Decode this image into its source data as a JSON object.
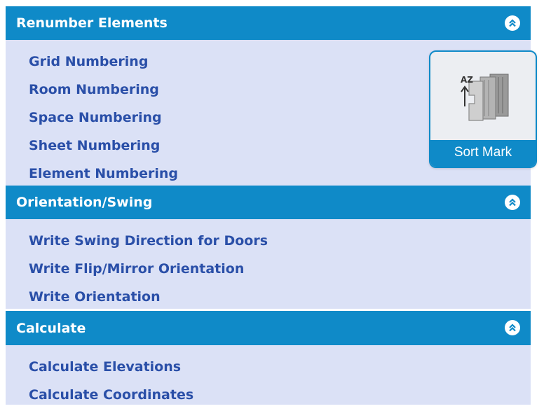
{
  "colors": {
    "header_bg": "#0f8ac8",
    "panel_bg": "#dbe1f6",
    "link_text": "#2a4fa8",
    "header_text": "#ffffff"
  },
  "sections": [
    {
      "title": "Renumber Elements",
      "collapse_icon": "double-chevron-up-icon",
      "items": [
        {
          "label": "Grid Numbering"
        },
        {
          "label": "Room Numbering"
        },
        {
          "label": "Space Numbering"
        },
        {
          "label": "Sheet Numbering"
        },
        {
          "label": "Element Numbering"
        }
      ]
    },
    {
      "title": "Orientation/Swing",
      "collapse_icon": "double-chevron-up-icon",
      "items": [
        {
          "label": "Write Swing Direction for Doors"
        },
        {
          "label": "Write Flip/Mirror Orientation"
        },
        {
          "label": "Write Orientation"
        }
      ]
    },
    {
      "title": "Calculate",
      "collapse_icon": "double-chevron-up-icon",
      "items": [
        {
          "label": "Calculate Elevations"
        },
        {
          "label": "Calculate Coordinates"
        }
      ]
    }
  ],
  "tool_card": {
    "label": "Sort Mark",
    "icon": "sort-mark-icon",
    "icon_text": "AZ"
  }
}
